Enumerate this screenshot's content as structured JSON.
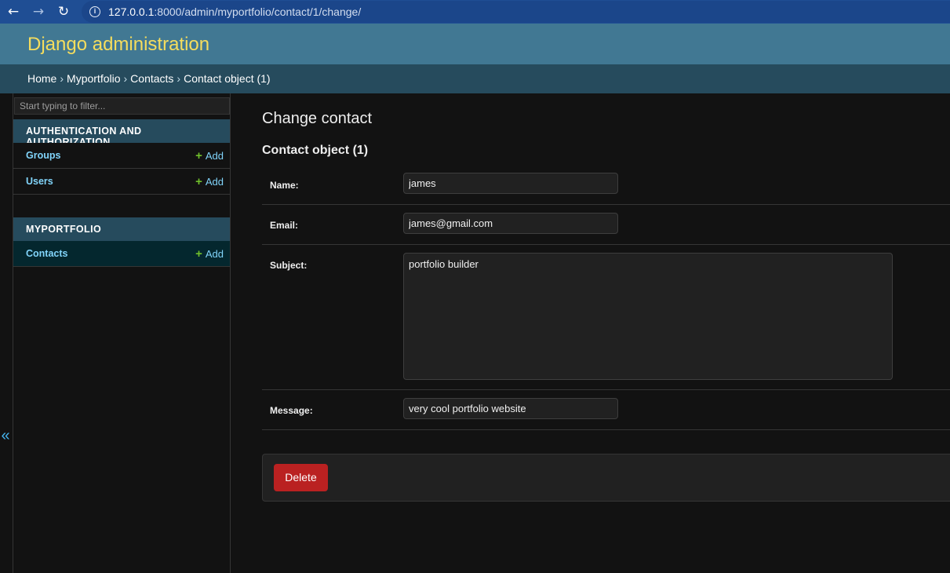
{
  "browser": {
    "back_icon": "arrow-left-icon",
    "forward_icon": "arrow-right-icon",
    "reload_icon": "reload-icon",
    "url_host": "127.0.0.1",
    "url_rest": ":8000/admin/myportfolio/contact/1/change/"
  },
  "header": {
    "brand": "Django administration"
  },
  "breadcrumbs": {
    "home": "Home",
    "app": "Myportfolio",
    "model": "Contacts",
    "current": "Contact object (1)",
    "separator": "›"
  },
  "sidebar": {
    "filter_placeholder": "Start typing to filter...",
    "toggle_label": "«",
    "modules": [
      {
        "caption": "AUTHENTICATION AND AUTHORIZATION",
        "models": [
          {
            "name": "Groups",
            "add": "Add"
          },
          {
            "name": "Users",
            "add": "Add"
          }
        ]
      },
      {
        "caption": "MYPORTFOLIO",
        "models": [
          {
            "name": "Contacts",
            "add": "Add"
          }
        ]
      }
    ]
  },
  "main": {
    "title": "Change contact",
    "object_title": "Contact object (1)",
    "fields": {
      "name": {
        "label": "Name:",
        "value": "james"
      },
      "email": {
        "label": "Email:",
        "value": "james@gmail.com"
      },
      "subject": {
        "label": "Subject:",
        "value": "portfolio builder"
      },
      "message": {
        "label": "Message:",
        "value": "very cool portfolio website"
      }
    },
    "delete_label": "Delete"
  },
  "colors": {
    "header_bg": "#417893",
    "brand_text": "#f5dd5d",
    "breadcrumb_bg": "#264b5d",
    "link": "#81d4fa",
    "add_plus": "#70bf2b",
    "delete_bg": "#ba2121",
    "page_bg": "#121212"
  }
}
